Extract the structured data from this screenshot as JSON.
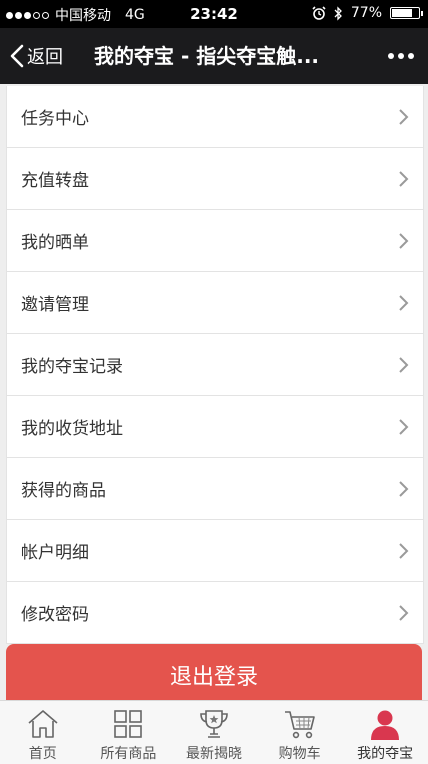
{
  "status_bar": {
    "carrier": "中国移动",
    "network": "4G",
    "time": "23:42",
    "battery": "77%",
    "battery_level": 0.77
  },
  "nav": {
    "back_label": "返回",
    "title": "我的夺宝 - 指尖夺宝触..."
  },
  "menu": [
    {
      "label": "任务中心"
    },
    {
      "label": "充值转盘"
    },
    {
      "label": "我的晒单"
    },
    {
      "label": "邀请管理"
    },
    {
      "label": "我的夺宝记录"
    },
    {
      "label": "我的收货地址"
    },
    {
      "label": "获得的商品"
    },
    {
      "label": "帐户明细"
    },
    {
      "label": "修改密码"
    }
  ],
  "logout_label": "退出登录",
  "tabs": [
    {
      "label": "首页",
      "icon": "home-icon"
    },
    {
      "label": "所有商品",
      "icon": "grid-icon"
    },
    {
      "label": "最新揭晓",
      "icon": "trophy-icon"
    },
    {
      "label": "购物车",
      "icon": "cart-icon"
    },
    {
      "label": "我的夺宝",
      "icon": "user-icon"
    }
  ],
  "colors": {
    "accent": "#e4544d",
    "active_tab": "#d9374f",
    "nav_bg": "#1b1b1d"
  }
}
